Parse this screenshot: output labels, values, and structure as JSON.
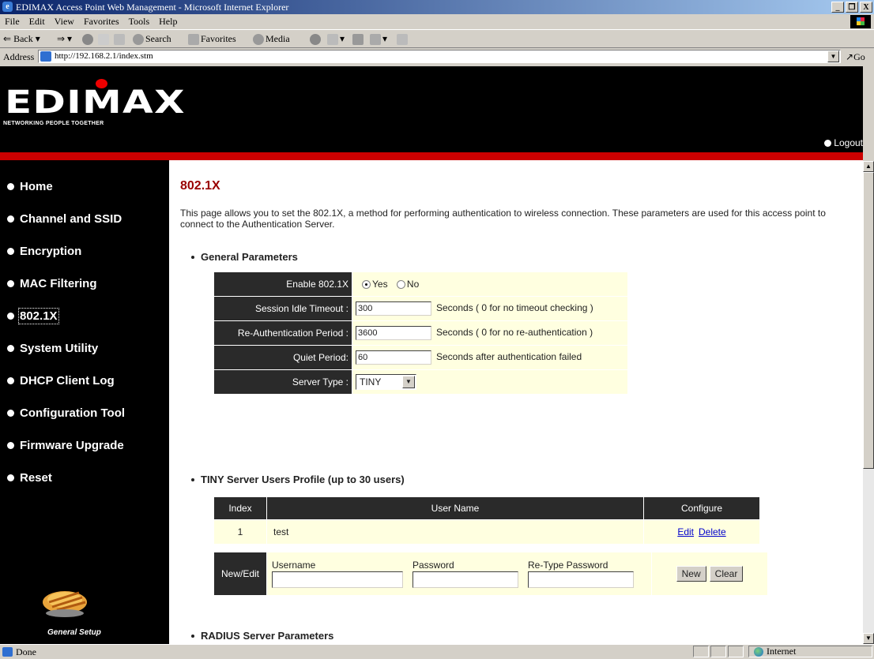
{
  "window": {
    "title": "EDIMAX Access Point Web Management - Microsoft Internet Explorer",
    "buttons": [
      "_",
      "̸",
      "X"
    ]
  },
  "menu": [
    "File",
    "Edit",
    "View",
    "Favorites",
    "Tools",
    "Help"
  ],
  "toolbar": {
    "back": "Back",
    "search": "Search",
    "favorites": "Favorites",
    "media": "Media"
  },
  "address": {
    "label": "Address",
    "url": "http://192.168.2.1/index.stm",
    "go": "Go"
  },
  "header": {
    "logo": "EDIMAX",
    "tagline": "NETWORKING PEOPLE TOGETHER",
    "logout": "Logout"
  },
  "nav": {
    "items": [
      "Home",
      "Channel and SSID",
      "Encryption",
      "MAC Filtering",
      "802.1X",
      "System Utility",
      "DHCP Client Log",
      "Configuration Tool",
      "Firmware Upgrade",
      "Reset"
    ],
    "selected": "802.1X",
    "footer": "General Setup"
  },
  "content": {
    "title": "802.1X",
    "description": "This page allows you to set the 802.1X, a method for performing authentication to wireless connection.  These parameters are used for this access point to connect to the Authentication Server.",
    "general_heading": "General Parameters",
    "enable": {
      "label": "Enable 802.1X",
      "yes": "Yes",
      "no": "No",
      "value": "Yes"
    },
    "session": {
      "label": "Session Idle Timeout :",
      "value": "300",
      "hint": "Seconds ( 0 for no timeout checking )"
    },
    "reauth": {
      "label": "Re-Authentication Period :",
      "value": "3600",
      "hint": "Seconds ( 0 for no re-authentication )"
    },
    "quiet": {
      "label": "Quiet Period:",
      "value": "60",
      "hint": "Seconds after authentication failed"
    },
    "server_type": {
      "label": "Server Type :",
      "value": "TINY"
    },
    "tiny_heading": "TINY Server Users Profile (up to 30 users)",
    "users_table": {
      "headers": [
        "Index",
        "User Name",
        "Configure"
      ],
      "rows": [
        {
          "index": "1",
          "user": "test",
          "edit": "Edit",
          "delete": "Delete"
        }
      ]
    },
    "new_edit": {
      "label": "New/Edit",
      "username": "Username",
      "password": "Password",
      "retype": "Re-Type Password",
      "new": "New",
      "clear": "Clear"
    },
    "radius_heading": "RADIUS Server Parameters"
  },
  "status": {
    "text": "Done",
    "zone": "Internet"
  }
}
